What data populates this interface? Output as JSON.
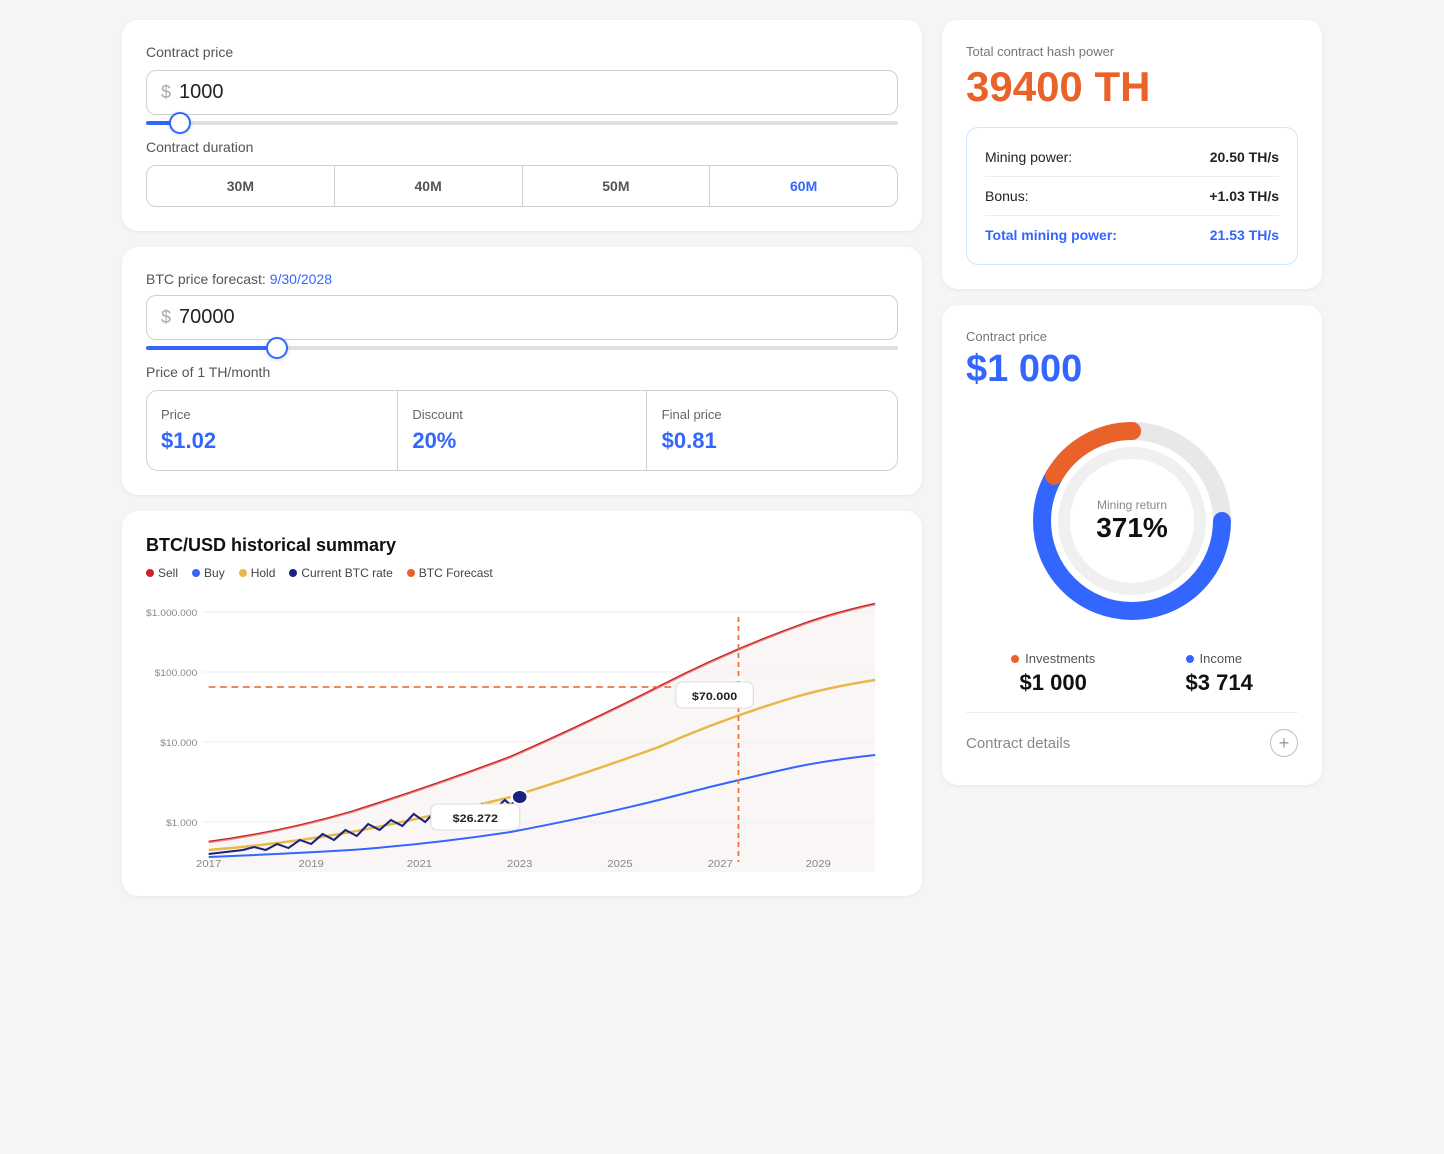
{
  "left": {
    "contract_price_label": "Contract price",
    "contract_price_value": "1000",
    "contract_price_symbol": "$",
    "duration_label": "Contract duration",
    "duration_tabs": [
      "30M",
      "40M",
      "50M",
      "60M"
    ],
    "active_tab_index": 3,
    "btc_forecast_label": "BTC price forecast:",
    "btc_forecast_date": "9/30/2028",
    "btc_price_symbol": "$",
    "btc_price_value": "70000",
    "th_price_label": "Price of 1 TH/month",
    "price_cell": {
      "label": "Price",
      "value": "$1.02"
    },
    "discount_cell": {
      "label": "Discount",
      "value": "20%"
    },
    "final_price_cell": {
      "label": "Final price",
      "value": "$0.81"
    },
    "chart_title": "BTC/USD historical summary",
    "legend": [
      {
        "label": "Sell",
        "color": "#cc2222"
      },
      {
        "label": "Buy",
        "color": "#3366ff"
      },
      {
        "label": "Hold",
        "color": "#e8b84b"
      },
      {
        "label": "Current BTC rate",
        "color": "#1a237e"
      },
      {
        "label": "BTC Forecast",
        "color": "#e8622a"
      }
    ],
    "chart_annotation_current": "$26.272",
    "chart_annotation_forecast": "$70.000",
    "chart_y_labels": [
      "$1.000.000",
      "$100.000",
      "$10.000",
      "$1.000"
    ],
    "chart_x_labels": [
      "2017",
      "2019",
      "2021",
      "2023",
      "2025",
      "2027",
      "2029"
    ]
  },
  "right": {
    "hash_label": "Total contract hash power",
    "hash_value": "39400 TH",
    "mining_power_label": "Mining power:",
    "mining_power_value": "20.50 TH/s",
    "bonus_label": "Bonus:",
    "bonus_value": "+1.03 TH/s",
    "total_mining_label": "Total mining power:",
    "total_mining_value": "21.53 TH/s",
    "contract_price_label": "Contract price",
    "contract_price_value": "$1 000",
    "donut_label": "Mining return",
    "donut_value": "371%",
    "investments_label": "Investments",
    "investments_value": "$1 000",
    "income_label": "Income",
    "income_value": "$3 714",
    "contract_details_label": "Contract details"
  }
}
